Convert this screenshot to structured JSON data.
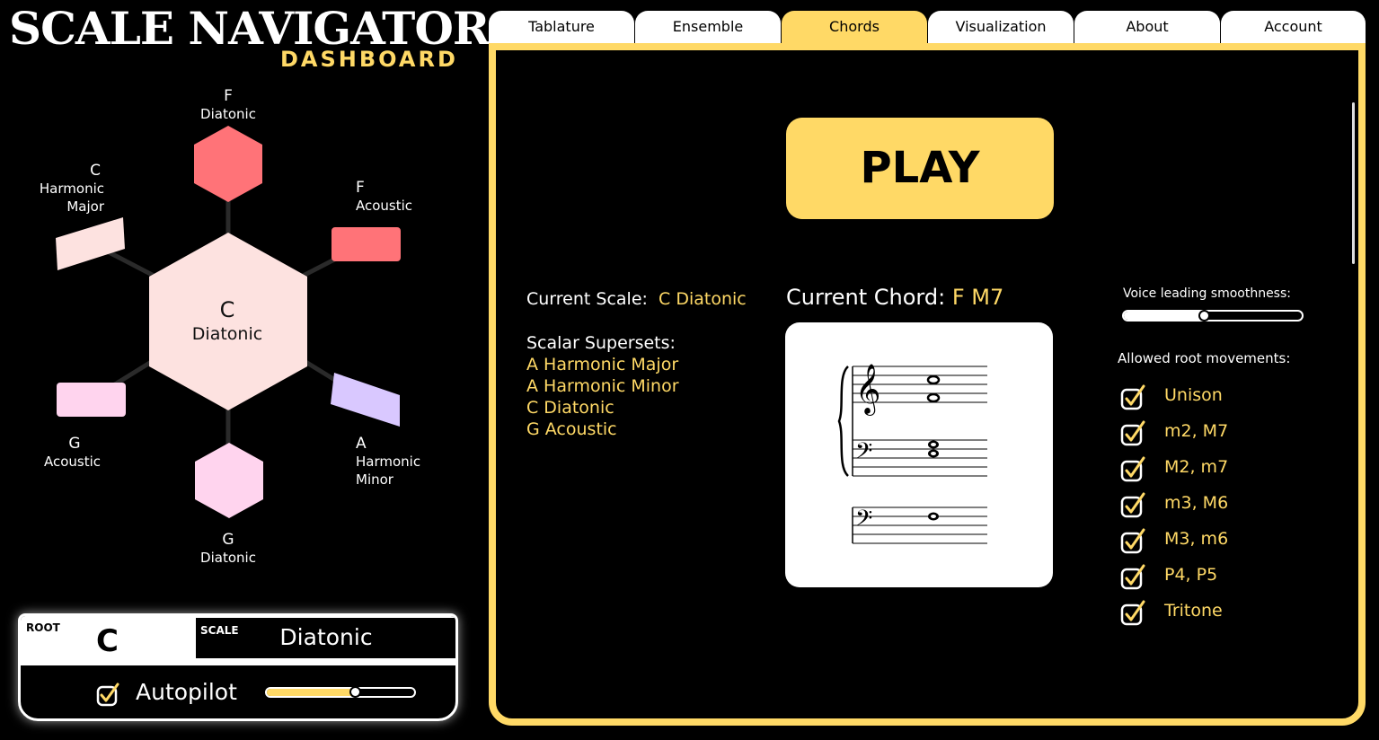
{
  "brand": {
    "title": "SCALE NAVIGATOR",
    "subtitle": "DASHBOARD"
  },
  "graph": {
    "center": {
      "root": "C",
      "scale": "Diatonic",
      "color": "#fde2e0"
    },
    "nodes": [
      {
        "root": "F",
        "scale": "Diatonic",
        "color": "#ff7378"
      },
      {
        "root": "F",
        "scale": "Acoustic",
        "color": "#ff7378"
      },
      {
        "root": "A",
        "scale": "Harmonic Minor",
        "color": "#d9c8ff"
      },
      {
        "root": "G",
        "scale": "Diatonic",
        "color": "#ffd4ee"
      },
      {
        "root": "G",
        "scale": "Acoustic",
        "color": "#ffd4ee"
      },
      {
        "root": "C",
        "scale": "Harmonic Major",
        "color": "#fde2e0"
      }
    ]
  },
  "control": {
    "root_label": "ROOT",
    "root_value": "C",
    "scale_label": "SCALE",
    "scale_value": "Diatonic",
    "autopilot_label": "Autopilot",
    "autopilot_checked": true,
    "autopilot_level": 0.6
  },
  "tabs": [
    {
      "label": "Tablature",
      "active": false
    },
    {
      "label": "Ensemble",
      "active": false
    },
    {
      "label": "Chords",
      "active": true
    },
    {
      "label": "Visualization",
      "active": false
    },
    {
      "label": "About",
      "active": false
    },
    {
      "label": "Account",
      "active": false
    }
  ],
  "main": {
    "play_label": "PLAY",
    "current_scale_label": "Current Scale:",
    "current_scale_value": "C Diatonic",
    "supersets_label": "Scalar Supersets:",
    "supersets": [
      "A Harmonic Major",
      "A Harmonic Minor",
      "C Diatonic",
      "G Acoustic"
    ],
    "current_chord_label": "Current Chord:",
    "current_chord_value": "F M7",
    "voice_leading_label": "Voice leading smoothness:",
    "voice_leading_level": 0.45,
    "root_movements_label": "Allowed root movements:",
    "root_movements": [
      {
        "label": "Unison",
        "checked": true
      },
      {
        "label": "m2, M7",
        "checked": true
      },
      {
        "label": "M2, m7",
        "checked": true
      },
      {
        "label": "m3, M6",
        "checked": true
      },
      {
        "label": "M3, m6",
        "checked": true
      },
      {
        "label": "P4, P5",
        "checked": true
      },
      {
        "label": "Tritone",
        "checked": true
      }
    ]
  },
  "colors": {
    "accent": "#ffd966",
    "background": "#000000"
  }
}
